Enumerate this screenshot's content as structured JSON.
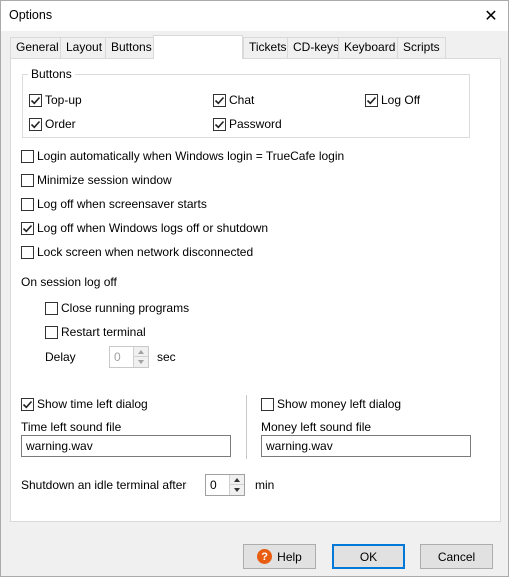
{
  "window": {
    "title": "Options"
  },
  "tabs": [
    {
      "label": "General"
    },
    {
      "label": "Layout"
    },
    {
      "label": "Buttons"
    },
    {
      "label": ""
    },
    {
      "label": "Tickets"
    },
    {
      "label": "CD-keys"
    },
    {
      "label": "Keyboard"
    },
    {
      "label": "Scripts"
    }
  ],
  "buttons_group": {
    "legend": "Buttons",
    "items": [
      {
        "label": "Top-up",
        "checked": true
      },
      {
        "label": "Chat",
        "checked": true
      },
      {
        "label": "Log Off",
        "checked": true
      },
      {
        "label": "Order",
        "checked": true
      },
      {
        "label": "Password",
        "checked": true
      }
    ]
  },
  "options": [
    {
      "label": "Login automatically when Windows login = TrueCafe login",
      "checked": false
    },
    {
      "label": "Minimize session window",
      "checked": false
    },
    {
      "label": "Log off when screensaver starts",
      "checked": false
    },
    {
      "label": "Log off when Windows logs off or shutdown",
      "checked": true
    },
    {
      "label": "Lock screen when network disconnected",
      "checked": false
    }
  ],
  "session_logoff": {
    "heading": "On session log off",
    "close_programs": {
      "label": "Close running programs",
      "checked": false
    },
    "restart_terminal": {
      "label": "Restart terminal",
      "checked": false
    },
    "delay_label": "Delay",
    "delay_value": "0",
    "delay_unit": "sec"
  },
  "time_left": {
    "show": {
      "label": "Show time left dialog",
      "checked": true
    },
    "sound_label": "Time left sound file",
    "sound_value": "warning.wav"
  },
  "money_left": {
    "show": {
      "label": "Show money left dialog",
      "checked": false
    },
    "sound_label": "Money left sound file",
    "sound_value": "warning.wav"
  },
  "idle": {
    "label": "Shutdown an idle terminal after",
    "value": "0",
    "unit": "min"
  },
  "footer": {
    "help": "Help",
    "ok": "OK",
    "cancel": "Cancel"
  }
}
